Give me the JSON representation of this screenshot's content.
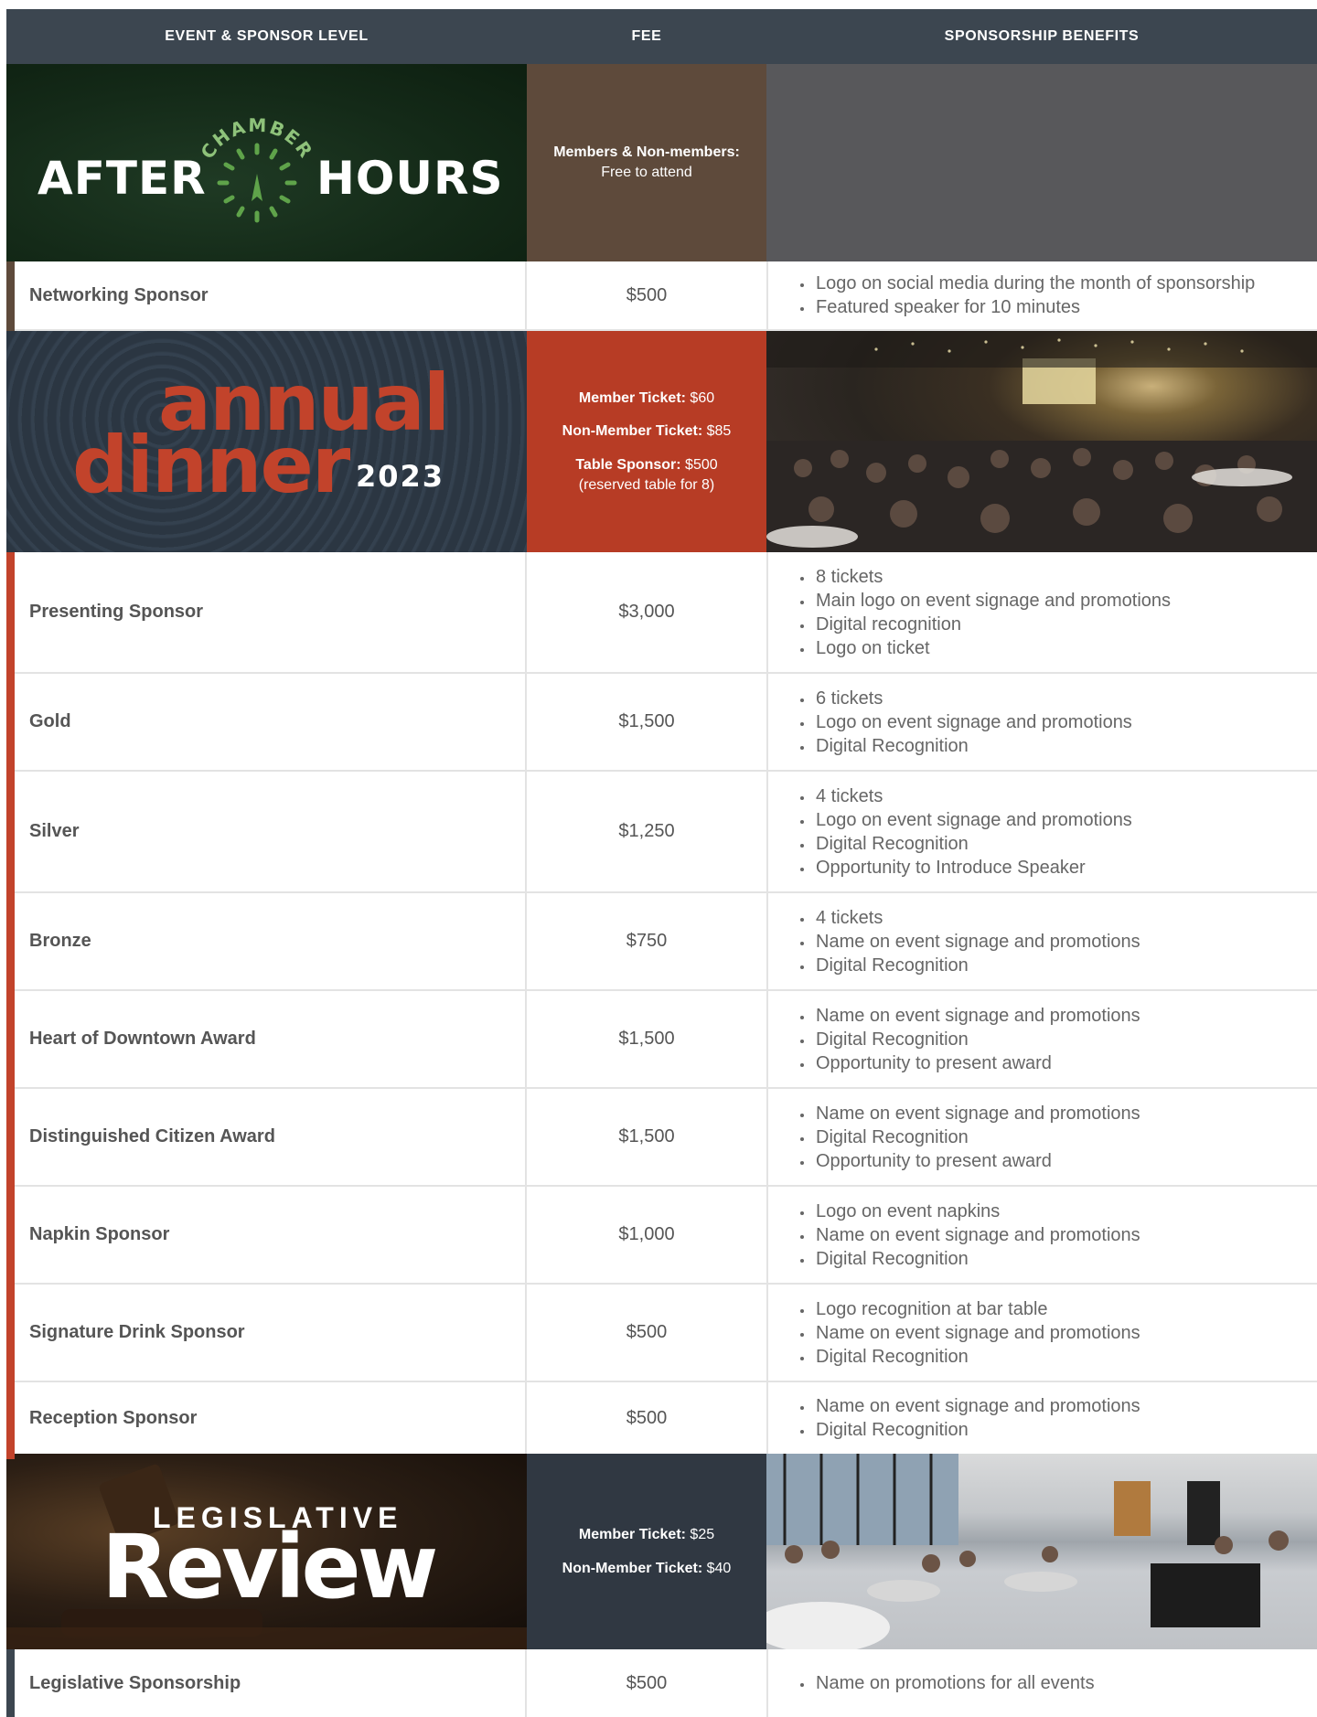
{
  "header": {
    "col1": "EVENT & SPONSOR LEVEL",
    "col2": "FEE",
    "col3": "SPONSORSHIP BENEFITS"
  },
  "colors": {
    "header_bg": "#3c4650",
    "after_hours_fee_bg": "#5e4a3b",
    "after_hours_benefits_bg": "#58585b",
    "after_hours_accent": "#5e4a3b",
    "dinner_fee_bg": "#b73c25",
    "dinner_accent": "#c2432b",
    "legislative_fee_bg": "#303842",
    "legislative_accent": "#3c4650"
  },
  "after_hours": {
    "logo": {
      "arc": "CHAMBER",
      "left": "AFTER",
      "right": "HOURS"
    },
    "fee": {
      "label": "Members & Non-members:",
      "value": "Free to attend"
    },
    "rows": [
      {
        "level": "Networking Sponsor",
        "fee": "$500",
        "benefits": [
          "Logo on social media during the month of sponsorship",
          "Featured speaker for 10 minutes"
        ]
      }
    ]
  },
  "annual_dinner": {
    "logo": {
      "word1": "annual",
      "word2": "dinner",
      "year": "2023"
    },
    "fee": {
      "member_label": "Member Ticket:",
      "member_value": " $60",
      "nonmember_label": "Non-Member Ticket:",
      "nonmember_value": " $85",
      "table_label": "Table Sponsor:",
      "table_value": " $500",
      "table_note": "(reserved table for 8)"
    },
    "rows": [
      {
        "level": "Presenting Sponsor",
        "fee": "$3,000",
        "benefits": [
          "8 tickets",
          "Main logo on event signage and promotions",
          "Digital recognition",
          "Logo on ticket"
        ]
      },
      {
        "level": "Gold",
        "fee": "$1,500",
        "benefits": [
          "6 tickets",
          "Logo on event signage and promotions",
          "Digital Recognition"
        ]
      },
      {
        "level": "Silver",
        "fee": "$1,250",
        "benefits": [
          "4 tickets",
          "Logo on event signage and promotions",
          "Digital Recognition",
          "Opportunity to Introduce Speaker"
        ]
      },
      {
        "level": "Bronze",
        "fee": "$750",
        "benefits": [
          "4 tickets",
          "Name on event signage and promotions",
          "Digital Recognition"
        ]
      },
      {
        "level": "Heart of Downtown Award",
        "fee": "$1,500",
        "benefits": [
          "Name on event signage and promotions",
          "Digital Recognition",
          "Opportunity to present award"
        ]
      },
      {
        "level": "Distinguished Citizen Award",
        "fee": "$1,500",
        "benefits": [
          "Name on event signage and promotions",
          "Digital Recognition",
          "Opportunity to present award"
        ]
      },
      {
        "level": "Napkin Sponsor",
        "fee": "$1,000",
        "benefits": [
          "Logo on event napkins",
          "Name on event signage and promotions",
          "Digital Recognition"
        ]
      },
      {
        "level": "Signature Drink Sponsor",
        "fee": "$500",
        "benefits": [
          "Logo recognition at bar table",
          "Name on event signage and promotions",
          "Digital Recognition"
        ]
      },
      {
        "level": "Reception Sponsor",
        "fee": "$500",
        "benefits": [
          "Name on event signage and promotions",
          "Digital Recognition"
        ]
      }
    ]
  },
  "legislative_review": {
    "logo": {
      "top": "LEGISLATIVE",
      "big": "Review"
    },
    "fee": {
      "member_label": "Member Ticket:",
      "member_value": " $25",
      "nonmember_label": "Non-Member Ticket:",
      "nonmember_value": " $40"
    },
    "rows": [
      {
        "level": "Legislative Sponsorship",
        "fee": "$500",
        "benefits": [
          "Name on promotions for all events"
        ]
      }
    ]
  }
}
